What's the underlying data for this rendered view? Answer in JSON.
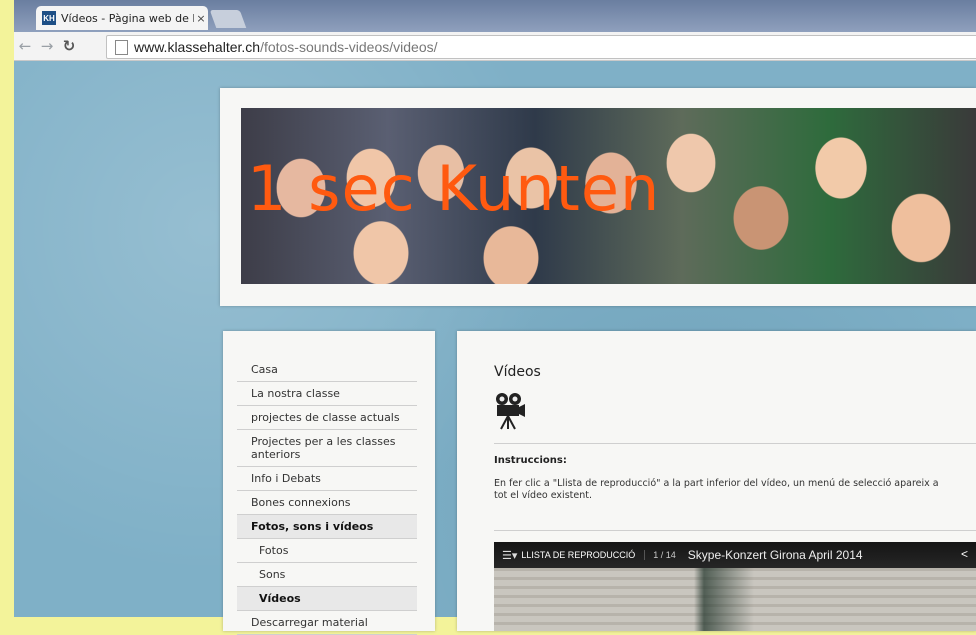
{
  "browser": {
    "tab_title": "Vídeos - Pàgina web de la",
    "tab_close": "×",
    "favicon_text": "KH",
    "url_host": "www.klassehalter.ch",
    "url_path": "/fotos-sounds-videos/videos/",
    "icons": [
      "back-arrow-icon",
      "forward-arrow-icon",
      "reload-icon",
      "page-icon"
    ]
  },
  "banner": {
    "title": "1 sec Kunten",
    "title_color": "#ff5a10"
  },
  "sidebar": {
    "items": [
      {
        "label": "Casa"
      },
      {
        "label": "La nostra classe"
      },
      {
        "label": "projectes de classe actuals"
      },
      {
        "label": "Projectes per a les classes anteriors"
      },
      {
        "label": "Info i Debats"
      },
      {
        "label": "Bones connexions"
      },
      {
        "label": "Fotos, sons i vídeos"
      },
      {
        "label": "Fotos"
      },
      {
        "label": "Sons"
      },
      {
        "label": "Vídeos"
      },
      {
        "label": "Descarregar material"
      }
    ]
  },
  "content": {
    "heading": "Vídeos",
    "instructions_label": "Instruccions:",
    "instructions_text": "En fer clic a \"Llista de reproducció\" a la part inferior del vídeo, un menú de selecció apareix a",
    "instructions_text2": "tot el vídeo existent.",
    "player": {
      "playlist_icon": "☰▾",
      "playlist_label": "LLISTA DE REPRODUCCIÓ",
      "counter": "1 / 14",
      "video_title": "Skype-Konzert Girona April 2014",
      "share_icon": "<"
    }
  }
}
